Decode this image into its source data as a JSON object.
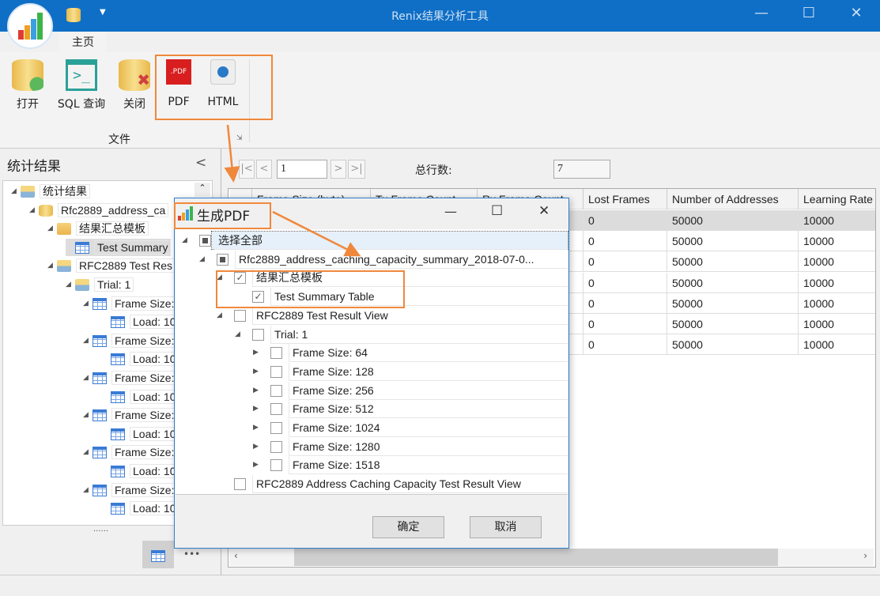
{
  "app": {
    "title": "Renix结果分析工具",
    "tab": "主页"
  },
  "ribbon": {
    "buttons": [
      {
        "label": "打开",
        "icon": "database-add-icon"
      },
      {
        "label": "SQL 查询",
        "icon": "terminal-icon"
      },
      {
        "label": "关闭",
        "icon": "database-close-icon"
      },
      {
        "label": "PDF",
        "icon": "pdf-icon"
      },
      {
        "label": "HTML",
        "icon": "html-globe-icon"
      }
    ],
    "group": "文件"
  },
  "left": {
    "title": "统计结果",
    "collapse": "<",
    "tree": [
      {
        "label": "统计结果",
        "icon": "folderimg",
        "level": 0,
        "arrow": true
      },
      {
        "label": "Rfc2889_address_ca",
        "icon": "dbi",
        "level": 1,
        "arrow": true
      },
      {
        "label": "结果汇总模板",
        "icon": "fold",
        "level": 2,
        "arrow": true
      },
      {
        "label": "Test Summary",
        "icon": "tbl",
        "level": 3,
        "arrow": false,
        "selected": true
      },
      {
        "label": "RFC2889 Test Res",
        "icon": "folderimg",
        "level": 2,
        "arrow": true
      },
      {
        "label": "Trial: 1",
        "icon": "folderimg",
        "level": 3,
        "arrow": true
      },
      {
        "label": "Frame Size:",
        "icon": "tbl",
        "level": 4,
        "arrow": true
      },
      {
        "label": "Load: 10",
        "icon": "tbl",
        "level": 5
      },
      {
        "label": "Frame Size:",
        "icon": "tbl",
        "level": 4,
        "arrow": true
      },
      {
        "label": "Load: 10",
        "icon": "tbl",
        "level": 5
      },
      {
        "label": "Frame Size:",
        "icon": "tbl",
        "level": 4,
        "arrow": true
      },
      {
        "label": "Load: 10",
        "icon": "tbl",
        "level": 5
      },
      {
        "label": "Frame Size:",
        "icon": "tbl",
        "level": 4,
        "arrow": true
      },
      {
        "label": "Load: 10",
        "icon": "tbl",
        "level": 5
      },
      {
        "label": "Frame Size:",
        "icon": "tbl",
        "level": 4,
        "arrow": true
      },
      {
        "label": "Load: 10",
        "icon": "tbl",
        "level": 5
      },
      {
        "label": "Frame Size:",
        "icon": "tbl",
        "level": 4,
        "arrow": true
      },
      {
        "label": "Load: 10",
        "icon": "tbl",
        "level": 5
      }
    ],
    "splitter": "......",
    "more": "•••"
  },
  "pager": {
    "first": "|<",
    "prev": "<",
    "page": "1",
    "next": ">",
    "last": ">|",
    "total_label": "总行数:",
    "total": "7"
  },
  "grid": {
    "columns": [
      "",
      "Frame Size (byte)",
      "Tx Frame Count",
      "Rx Frame Count",
      "Lost Frames",
      "Number of Addresses",
      "Learning Rate"
    ],
    "rows": [
      [
        "",
        "",
        "",
        "",
        "0",
        "50000",
        "10000"
      ],
      [
        "",
        "",
        "",
        "",
        "0",
        "50000",
        "10000"
      ],
      [
        "",
        "",
        "",
        "",
        "0",
        "50000",
        "10000"
      ],
      [
        "",
        "",
        "",
        "",
        "0",
        "50000",
        "10000"
      ],
      [
        "",
        "",
        "",
        "",
        "0",
        "50000",
        "10000"
      ],
      [
        "",
        "",
        "",
        "",
        "0",
        "50000",
        "10000"
      ],
      [
        "",
        "",
        "",
        "",
        "0",
        "50000",
        "10000"
      ]
    ]
  },
  "dialog": {
    "title": "生成PDF",
    "ok": "确定",
    "cancel": "取消",
    "tree": [
      {
        "label": "选择全部",
        "level": 0,
        "check": "part",
        "arrow": "down"
      },
      {
        "label": "Rfc2889_address_caching_capacity_summary_2018-07-0...",
        "level": 1,
        "check": "part",
        "arrow": "down"
      },
      {
        "label": "结果汇总模板",
        "level": 2,
        "check": "on",
        "arrow": "down"
      },
      {
        "label": "Test Summary Table",
        "level": 3,
        "check": "on"
      },
      {
        "label": "RFC2889 Test Result View",
        "level": 2,
        "check": "off",
        "arrow": "down"
      },
      {
        "label": "Trial: 1",
        "level": 3,
        "check": "off",
        "arrow": "down"
      },
      {
        "label": "Frame Size: 64",
        "level": 4,
        "check": "off",
        "arrow": "right"
      },
      {
        "label": "Frame Size: 128",
        "level": 4,
        "check": "off",
        "arrow": "right"
      },
      {
        "label": "Frame Size: 256",
        "level": 4,
        "check": "off",
        "arrow": "right"
      },
      {
        "label": "Frame Size: 512",
        "level": 4,
        "check": "off",
        "arrow": "right"
      },
      {
        "label": "Frame Size: 1024",
        "level": 4,
        "check": "off",
        "arrow": "right"
      },
      {
        "label": "Frame Size: 1280",
        "level": 4,
        "check": "off",
        "arrow": "right"
      },
      {
        "label": "Frame Size: 1518",
        "level": 4,
        "check": "off",
        "arrow": "right"
      },
      {
        "label": "RFC2889 Address Caching Capacity Test Result View",
        "level": 2,
        "check": "off"
      }
    ]
  },
  "colors": {
    "titlebar": "#0f6fc6",
    "highlight": "#f0883c"
  }
}
